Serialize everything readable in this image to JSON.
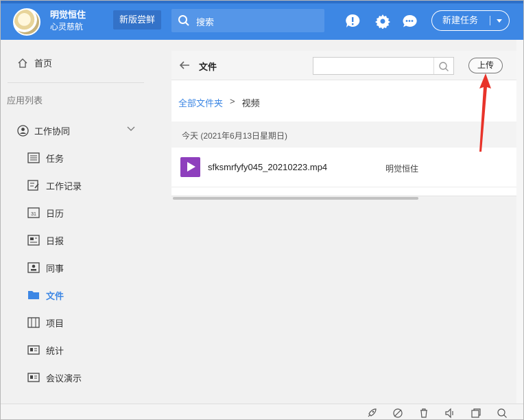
{
  "header": {
    "user_name": "明觉恒住",
    "user_sub": "心灵慈航",
    "new_version_label": "新版尝鲜",
    "search_placeholder": "搜索",
    "new_task_label": "新建任务",
    "icons": [
      "alert-icon",
      "gear-icon",
      "chat-icon"
    ],
    "accent_color": "#3d87e4"
  },
  "sidebar": {
    "home_label": "首页",
    "app_list_title": "应用列表",
    "group_label": "工作协同",
    "items": [
      {
        "label": "任务",
        "icon": "task-icon"
      },
      {
        "label": "工作记录",
        "icon": "work-record-icon"
      },
      {
        "label": "日历",
        "icon": "calendar-icon"
      },
      {
        "label": "日报",
        "icon": "daily-report-icon"
      },
      {
        "label": "同事",
        "icon": "colleague-icon"
      },
      {
        "label": "文件",
        "icon": "folder-icon",
        "active": true
      },
      {
        "label": "项目",
        "icon": "project-icon"
      },
      {
        "label": "统计",
        "icon": "stats-icon"
      },
      {
        "label": "会议演示",
        "icon": "meeting-icon"
      }
    ]
  },
  "files": {
    "title": "文件",
    "upload_label": "上传",
    "breadcrumb_root": "全部文件夹",
    "breadcrumb_sep": ">",
    "breadcrumb_current": "视频",
    "date_group": "今天 (2021年6月13日星期日)",
    "rows": [
      {
        "name": "sfksmrfyfy045_20210223.mp4",
        "owner": "明觉恒住",
        "type": "video"
      }
    ]
  },
  "statusbar": {
    "icons": [
      "rocket-icon",
      "no-disturb-icon",
      "trash-icon",
      "volume-icon",
      "window-icon",
      "search-icon"
    ]
  }
}
